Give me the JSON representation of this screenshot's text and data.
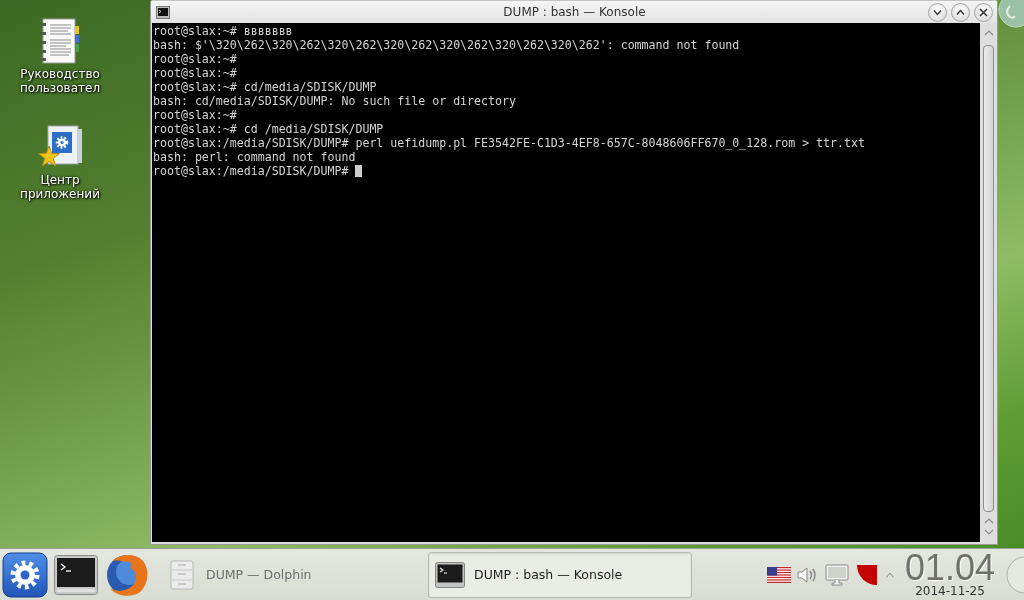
{
  "desktop": {
    "icons": [
      {
        "kind": "document",
        "label": "Руководство пользовател"
      },
      {
        "kind": "package",
        "label": "Центр приложений"
      }
    ]
  },
  "window": {
    "title": "DUMP : bash — Konsole",
    "terminal": {
      "lines": [
        "root@slax:~# ввввввв",
        "bash: $'\\320\\262\\320\\262\\320\\262\\320\\262\\320\\262\\320\\262\\320\\262': command not found",
        "root@slax:~#",
        "root@slax:~#",
        "root@slax:~# cd/media/SDISK/DUMP",
        "bash: cd/media/SDISK/DUMP: No such file or directory",
        "root@slax:~#",
        "root@slax:~# cd /media/SDISK/DUMP",
        "root@slax:/media/SDISK/DUMP# perl uefidump.pl FE3542FE-C1D3-4EF8-657C-8048606FF670_0_128.rom > ttr.txt",
        "bash: perl: command not found",
        "root@slax:/media/SDISK/DUMP#"
      ],
      "cursor": true
    }
  },
  "taskbar": {
    "tasks": [
      {
        "kind": "files",
        "label": "DUMP — Dolphin",
        "selected": false
      },
      {
        "kind": "terminal",
        "label": "DUMP : bash — Konsole",
        "selected": true
      }
    ],
    "clock": {
      "time": "01.04",
      "date": "2014-11-25"
    }
  }
}
